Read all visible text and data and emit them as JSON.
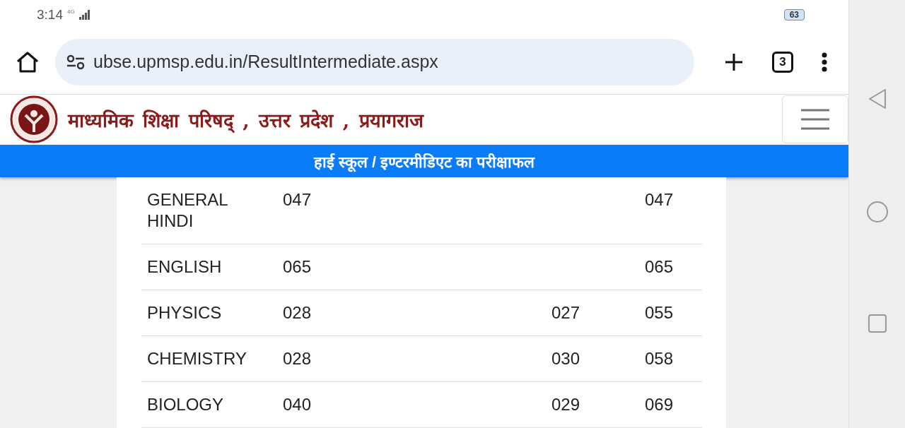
{
  "status_bar": {
    "time": "3:14",
    "network": "4G",
    "battery": "63"
  },
  "browser": {
    "url": "ubse.upmsp.edu.in/ResultIntermediate.aspx",
    "tab_count": "3"
  },
  "site_header": {
    "title": "माध्यमिक शिक्षा परिषद् , उत्तर प्रदेश , प्रयागराज"
  },
  "banner": {
    "text": "हाई स्कूल / इण्टरमीडिएट का परीक्षाफल"
  },
  "table": {
    "rows": [
      {
        "cells": [
          "GENERAL HINDI",
          "047",
          "",
          "047"
        ]
      },
      {
        "cells": [
          "ENGLISH",
          "065",
          "",
          "065"
        ]
      },
      {
        "cells": [
          "PHYSICS",
          "028",
          "027",
          "055"
        ]
      },
      {
        "cells": [
          "CHEMISTRY",
          "028",
          "030",
          "058"
        ]
      },
      {
        "cells": [
          "BIOLOGY",
          "040",
          "029",
          "069"
        ]
      }
    ]
  }
}
